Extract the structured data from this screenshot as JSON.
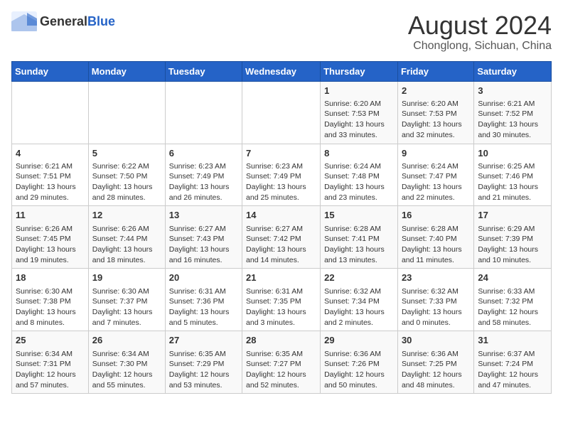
{
  "header": {
    "logo": {
      "general": "General",
      "blue": "Blue"
    },
    "title": "August 2024",
    "subtitle": "Chonglong, Sichuan, China"
  },
  "weekdays": [
    "Sunday",
    "Monday",
    "Tuesday",
    "Wednesday",
    "Thursday",
    "Friday",
    "Saturday"
  ],
  "weeks": [
    [
      {
        "day": "",
        "info": ""
      },
      {
        "day": "",
        "info": ""
      },
      {
        "day": "",
        "info": ""
      },
      {
        "day": "",
        "info": ""
      },
      {
        "day": "1",
        "info": "Sunrise: 6:20 AM\nSunset: 7:53 PM\nDaylight: 13 hours\nand 33 minutes."
      },
      {
        "day": "2",
        "info": "Sunrise: 6:20 AM\nSunset: 7:53 PM\nDaylight: 13 hours\nand 32 minutes."
      },
      {
        "day": "3",
        "info": "Sunrise: 6:21 AM\nSunset: 7:52 PM\nDaylight: 13 hours\nand 30 minutes."
      }
    ],
    [
      {
        "day": "4",
        "info": "Sunrise: 6:21 AM\nSunset: 7:51 PM\nDaylight: 13 hours\nand 29 minutes."
      },
      {
        "day": "5",
        "info": "Sunrise: 6:22 AM\nSunset: 7:50 PM\nDaylight: 13 hours\nand 28 minutes."
      },
      {
        "day": "6",
        "info": "Sunrise: 6:23 AM\nSunset: 7:49 PM\nDaylight: 13 hours\nand 26 minutes."
      },
      {
        "day": "7",
        "info": "Sunrise: 6:23 AM\nSunset: 7:49 PM\nDaylight: 13 hours\nand 25 minutes."
      },
      {
        "day": "8",
        "info": "Sunrise: 6:24 AM\nSunset: 7:48 PM\nDaylight: 13 hours\nand 23 minutes."
      },
      {
        "day": "9",
        "info": "Sunrise: 6:24 AM\nSunset: 7:47 PM\nDaylight: 13 hours\nand 22 minutes."
      },
      {
        "day": "10",
        "info": "Sunrise: 6:25 AM\nSunset: 7:46 PM\nDaylight: 13 hours\nand 21 minutes."
      }
    ],
    [
      {
        "day": "11",
        "info": "Sunrise: 6:26 AM\nSunset: 7:45 PM\nDaylight: 13 hours\nand 19 minutes."
      },
      {
        "day": "12",
        "info": "Sunrise: 6:26 AM\nSunset: 7:44 PM\nDaylight: 13 hours\nand 18 minutes."
      },
      {
        "day": "13",
        "info": "Sunrise: 6:27 AM\nSunset: 7:43 PM\nDaylight: 13 hours\nand 16 minutes."
      },
      {
        "day": "14",
        "info": "Sunrise: 6:27 AM\nSunset: 7:42 PM\nDaylight: 13 hours\nand 14 minutes."
      },
      {
        "day": "15",
        "info": "Sunrise: 6:28 AM\nSunset: 7:41 PM\nDaylight: 13 hours\nand 13 minutes."
      },
      {
        "day": "16",
        "info": "Sunrise: 6:28 AM\nSunset: 7:40 PM\nDaylight: 13 hours\nand 11 minutes."
      },
      {
        "day": "17",
        "info": "Sunrise: 6:29 AM\nSunset: 7:39 PM\nDaylight: 13 hours\nand 10 minutes."
      }
    ],
    [
      {
        "day": "18",
        "info": "Sunrise: 6:30 AM\nSunset: 7:38 PM\nDaylight: 13 hours\nand 8 minutes."
      },
      {
        "day": "19",
        "info": "Sunrise: 6:30 AM\nSunset: 7:37 PM\nDaylight: 13 hours\nand 7 minutes."
      },
      {
        "day": "20",
        "info": "Sunrise: 6:31 AM\nSunset: 7:36 PM\nDaylight: 13 hours\nand 5 minutes."
      },
      {
        "day": "21",
        "info": "Sunrise: 6:31 AM\nSunset: 7:35 PM\nDaylight: 13 hours\nand 3 minutes."
      },
      {
        "day": "22",
        "info": "Sunrise: 6:32 AM\nSunset: 7:34 PM\nDaylight: 13 hours\nand 2 minutes."
      },
      {
        "day": "23",
        "info": "Sunrise: 6:32 AM\nSunset: 7:33 PM\nDaylight: 13 hours\nand 0 minutes."
      },
      {
        "day": "24",
        "info": "Sunrise: 6:33 AM\nSunset: 7:32 PM\nDaylight: 12 hours\nand 58 minutes."
      }
    ],
    [
      {
        "day": "25",
        "info": "Sunrise: 6:34 AM\nSunset: 7:31 PM\nDaylight: 12 hours\nand 57 minutes."
      },
      {
        "day": "26",
        "info": "Sunrise: 6:34 AM\nSunset: 7:30 PM\nDaylight: 12 hours\nand 55 minutes."
      },
      {
        "day": "27",
        "info": "Sunrise: 6:35 AM\nSunset: 7:29 PM\nDaylight: 12 hours\nand 53 minutes."
      },
      {
        "day": "28",
        "info": "Sunrise: 6:35 AM\nSunset: 7:27 PM\nDaylight: 12 hours\nand 52 minutes."
      },
      {
        "day": "29",
        "info": "Sunrise: 6:36 AM\nSunset: 7:26 PM\nDaylight: 12 hours\nand 50 minutes."
      },
      {
        "day": "30",
        "info": "Sunrise: 6:36 AM\nSunset: 7:25 PM\nDaylight: 12 hours\nand 48 minutes."
      },
      {
        "day": "31",
        "info": "Sunrise: 6:37 AM\nSunset: 7:24 PM\nDaylight: 12 hours\nand 47 minutes."
      }
    ]
  ]
}
